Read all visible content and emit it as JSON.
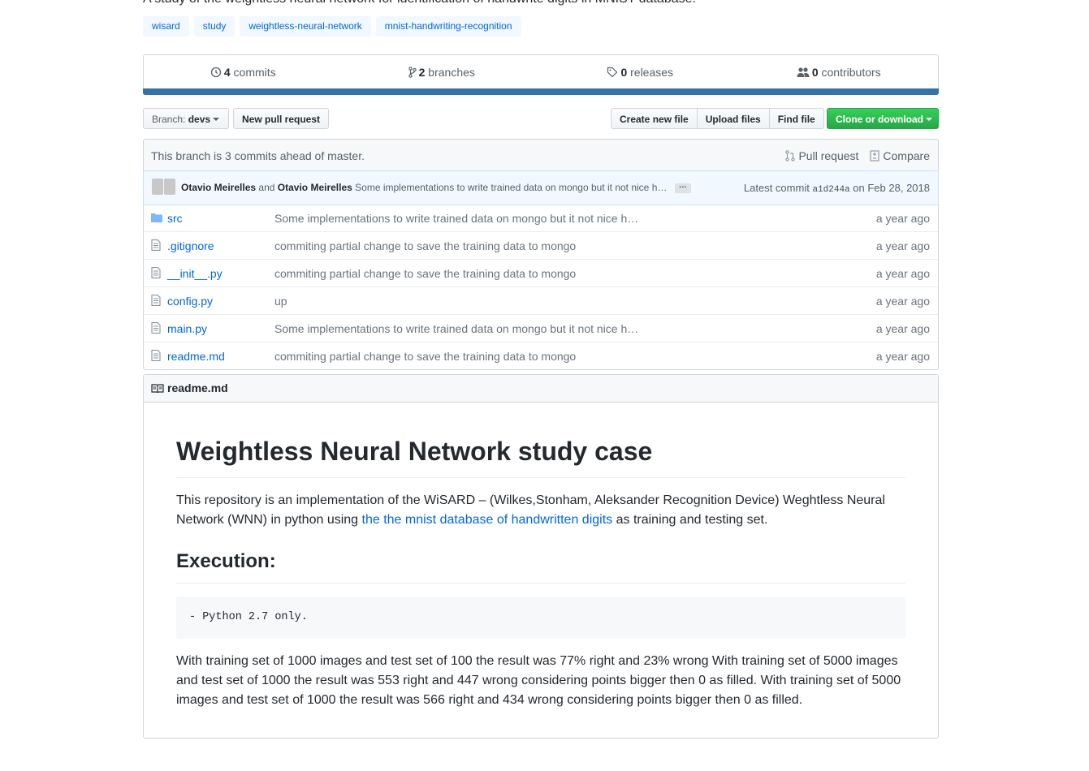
{
  "repo": {
    "description": "A study of the weightless neural network for identification of handwrite digits in MNIST database.",
    "topics": [
      "wisard",
      "study",
      "weightless-neural-network",
      "mnist-handwriting-recognition"
    ]
  },
  "numbers": {
    "commits_count": "4",
    "commits_label": "commits",
    "branches_count": "2",
    "branches_label": "branches",
    "releases_count": "0",
    "releases_label": "releases",
    "contributors_count": "0",
    "contributors_label": "contributors"
  },
  "language_color": "#3572A5",
  "toolbar": {
    "branch_prefix": "Branch:",
    "branch_name": "devs",
    "new_pull_request": "New pull request",
    "create_new_file": "Create new file",
    "upload_files": "Upload files",
    "find_file": "Find file",
    "clone_or_download": "Clone or download"
  },
  "branch_info": {
    "message": "This branch is 3 commits ahead of master.",
    "pull_request": "Pull request",
    "compare": "Compare"
  },
  "commit": {
    "author1": "Otavio Meirelles",
    "and": "and",
    "author2": "Otavio Meirelles",
    "message": "Some implementations to write trained data on mongo but it not nice h…",
    "ellipsis": "…",
    "latest_label": "Latest commit",
    "sha": "a1d244a",
    "date": "on Feb 28, 2018"
  },
  "files": [
    {
      "name": "src",
      "type": "dir",
      "message": "Some implementations to write trained data on mongo but it not nice h…",
      "age": "a year ago"
    },
    {
      "name": ".gitignore",
      "type": "file",
      "message": "commiting partial change to save the training data to mongo",
      "age": "a year ago"
    },
    {
      "name": "__init__.py",
      "type": "file",
      "message": "commiting partial change to save the training data to mongo",
      "age": "a year ago"
    },
    {
      "name": "config.py",
      "type": "file",
      "message": "up",
      "age": "a year ago"
    },
    {
      "name": "main.py",
      "type": "file",
      "message": "Some implementations to write trained data on mongo but it not nice h…",
      "age": "a year ago"
    },
    {
      "name": "readme.md",
      "type": "file",
      "message": "commiting partial change to save the training data to mongo",
      "age": "a year ago"
    }
  ],
  "readme": {
    "filename": "readme.md",
    "h1": "Weightless Neural Network study case",
    "intro_before": "This repository is an implementation of the WiSARD – (Wilkes,Stonham, Aleksander Recognition Device) Weghtless Neural Network (WNN) in python using ",
    "intro_link": "the the mnist database of handwritten digits",
    "intro_after": " as training and testing set.",
    "h2": "Execution:",
    "code": "- Python 2.7 only.",
    "results": "With training set of 1000 images and test set of 100 the result was 77% right and 23% wrong With training set of 5000 images and test set of 1000 the result was 553 right and 447 wrong considering points bigger then 0 as filled. With training set of 5000 images and test set of 1000 the result was 566 right and 434 wrong considering points bigger then 0 as filled."
  }
}
